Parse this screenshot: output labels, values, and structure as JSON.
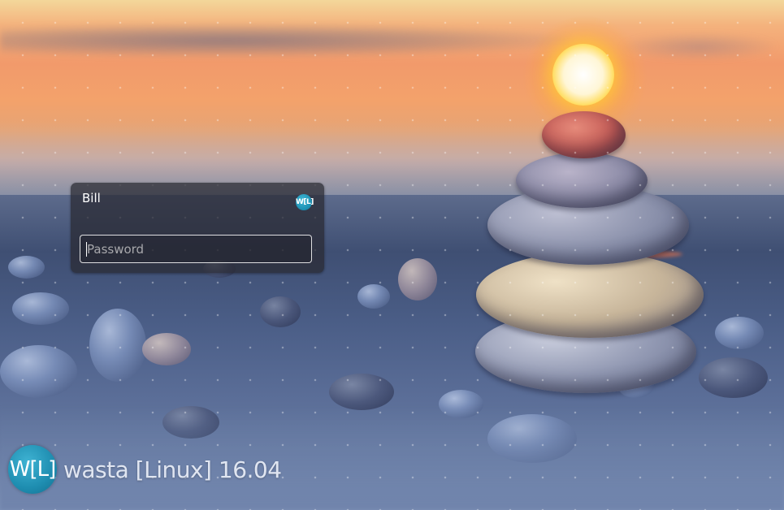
{
  "login": {
    "user_name": "Bill",
    "session_badge": "W[L]",
    "password_placeholder": "Password",
    "password_value": ""
  },
  "branding": {
    "icon_text": "W[L]",
    "text": "wasta [Linux] 16.04"
  },
  "colors": {
    "accent": "#1e8db0",
    "login_bg": "#28282f"
  }
}
